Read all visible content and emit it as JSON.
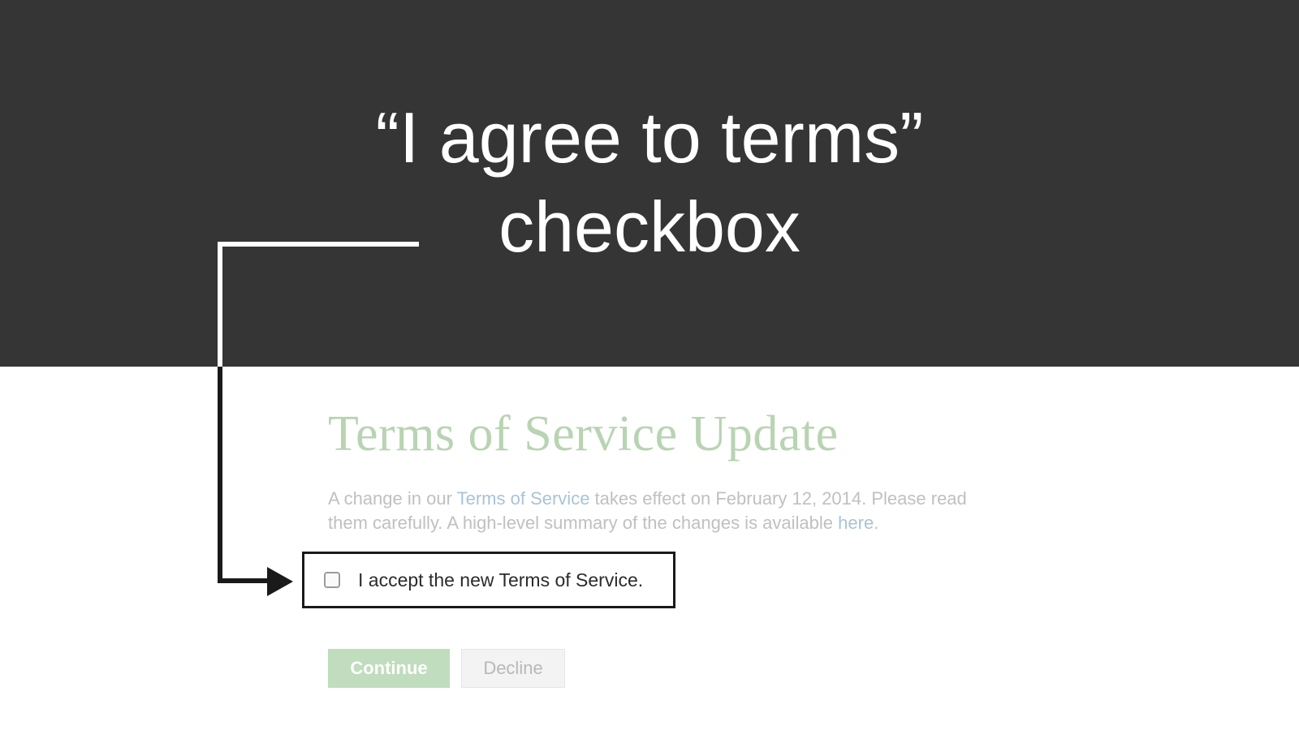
{
  "slide": {
    "title": "“I agree to terms”\ncheckbox"
  },
  "tos": {
    "heading": "Terms of Service Update",
    "body_part1": "A change in our ",
    "link1": "Terms of Service",
    "body_part2": " takes effect on February 12, 2014. Please read them carefully. A high-level summary of the changes is available ",
    "link2": "here",
    "body_part3": ".",
    "checkbox_label": "I accept the new Terms of Service.",
    "continue_label": "Continue",
    "decline_label": "Decline"
  }
}
